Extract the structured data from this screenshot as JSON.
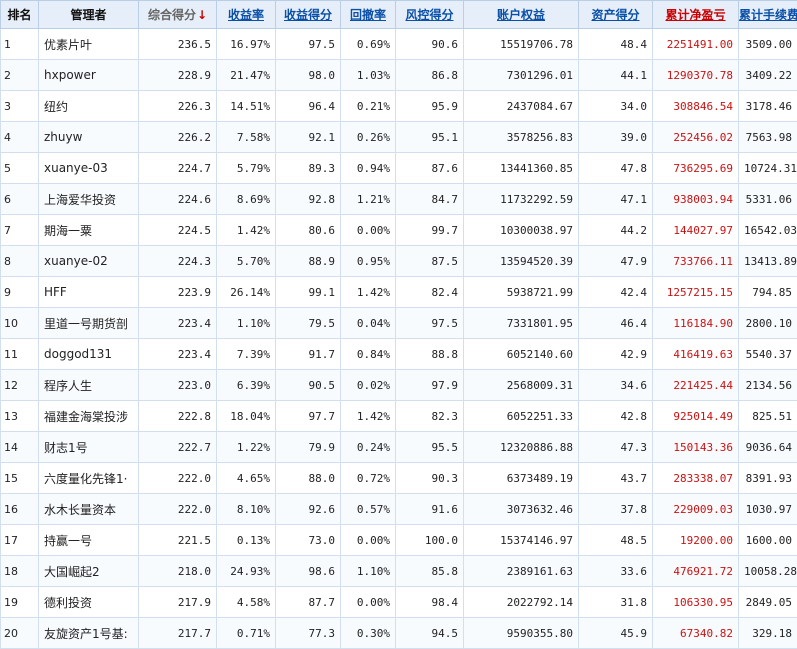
{
  "table": {
    "headers": [
      "排名",
      "管理者",
      "综合得分",
      "收益率",
      "收益得分",
      "回撤率",
      "风控得分",
      "账户权益",
      "资产得分",
      "累计净盈亏",
      "累计手续费"
    ],
    "sort_indicator": "↓",
    "rows": [
      [
        "1",
        "优素片叶",
        "236.5",
        "16.97%",
        "97.5",
        "0.69%",
        "90.6",
        "15519706.78",
        "48.4",
        "2251491.00",
        "3509.00"
      ],
      [
        "2",
        "hxpower",
        "228.9",
        "21.47%",
        "98.0",
        "1.03%",
        "86.8",
        "7301296.01",
        "44.1",
        "1290370.78",
        "3409.22"
      ],
      [
        "3",
        "纽约",
        "226.3",
        "14.51%",
        "96.4",
        "0.21%",
        "95.9",
        "2437084.67",
        "34.0",
        "308846.54",
        "3178.46"
      ],
      [
        "4",
        "zhuyw",
        "226.2",
        "7.58%",
        "92.1",
        "0.26%",
        "95.1",
        "3578256.83",
        "39.0",
        "252456.02",
        "7563.98"
      ],
      [
        "5",
        "xuanye-03",
        "224.7",
        "5.79%",
        "89.3",
        "0.94%",
        "87.6",
        "13441360.85",
        "47.8",
        "736295.69",
        "10724.31"
      ],
      [
        "6",
        "上海爱华投资",
        "224.6",
        "8.69%",
        "92.8",
        "1.21%",
        "84.7",
        "11732292.59",
        "47.1",
        "938003.94",
        "5331.06"
      ],
      [
        "7",
        "期海一粟",
        "224.5",
        "1.42%",
        "80.6",
        "0.00%",
        "99.7",
        "10300038.97",
        "44.2",
        "144027.97",
        "16542.03"
      ],
      [
        "8",
        "xuanye-02",
        "224.3",
        "5.70%",
        "88.9",
        "0.95%",
        "87.5",
        "13594520.39",
        "47.9",
        "733766.11",
        "13413.89"
      ],
      [
        "9",
        "HFF",
        "223.9",
        "26.14%",
        "99.1",
        "1.42%",
        "82.4",
        "5938721.99",
        "42.4",
        "1257215.15",
        "794.85"
      ],
      [
        "10",
        "里道一号期货剖",
        "223.4",
        "1.10%",
        "79.5",
        "0.04%",
        "97.5",
        "7331801.95",
        "46.4",
        "116184.90",
        "2800.10"
      ],
      [
        "11",
        "doggod131",
        "223.4",
        "7.39%",
        "91.7",
        "0.84%",
        "88.8",
        "6052140.60",
        "42.9",
        "416419.63",
        "5540.37"
      ],
      [
        "12",
        "程序人生",
        "223.0",
        "6.39%",
        "90.5",
        "0.02%",
        "97.9",
        "2568009.31",
        "34.6",
        "221425.44",
        "2134.56"
      ],
      [
        "13",
        "福建金海棠投涉",
        "222.8",
        "18.04%",
        "97.7",
        "1.42%",
        "82.3",
        "6052251.33",
        "42.8",
        "925014.49",
        "825.51"
      ],
      [
        "14",
        "财志1号",
        "222.7",
        "1.22%",
        "79.9",
        "0.24%",
        "95.5",
        "12320886.88",
        "47.3",
        "150143.36",
        "9036.64"
      ],
      [
        "15",
        "六度量化先锋1·",
        "222.0",
        "4.65%",
        "88.0",
        "0.72%",
        "90.3",
        "6373489.19",
        "43.7",
        "283338.07",
        "8391.93"
      ],
      [
        "16",
        "水木长量资本",
        "222.0",
        "8.10%",
        "92.6",
        "0.57%",
        "91.6",
        "3073632.46",
        "37.8",
        "229009.03",
        "1030.97"
      ],
      [
        "17",
        "持赢一号",
        "221.5",
        "0.13%",
        "73.0",
        "0.00%",
        "100.0",
        "15374146.97",
        "48.5",
        "19200.00",
        "1600.00"
      ],
      [
        "18",
        "大国崛起2",
        "218.0",
        "24.93%",
        "98.6",
        "1.10%",
        "85.8",
        "2389161.63",
        "33.6",
        "476921.72",
        "10058.28"
      ],
      [
        "19",
        "德利投资",
        "217.9",
        "4.58%",
        "87.7",
        "0.00%",
        "98.4",
        "2022792.14",
        "31.8",
        "106330.95",
        "2849.05"
      ],
      [
        "20",
        "友旋资产1号基:",
        "217.7",
        "0.71%",
        "77.3",
        "0.30%",
        "94.5",
        "9590355.80",
        "45.9",
        "67340.82",
        "329.18"
      ]
    ]
  }
}
